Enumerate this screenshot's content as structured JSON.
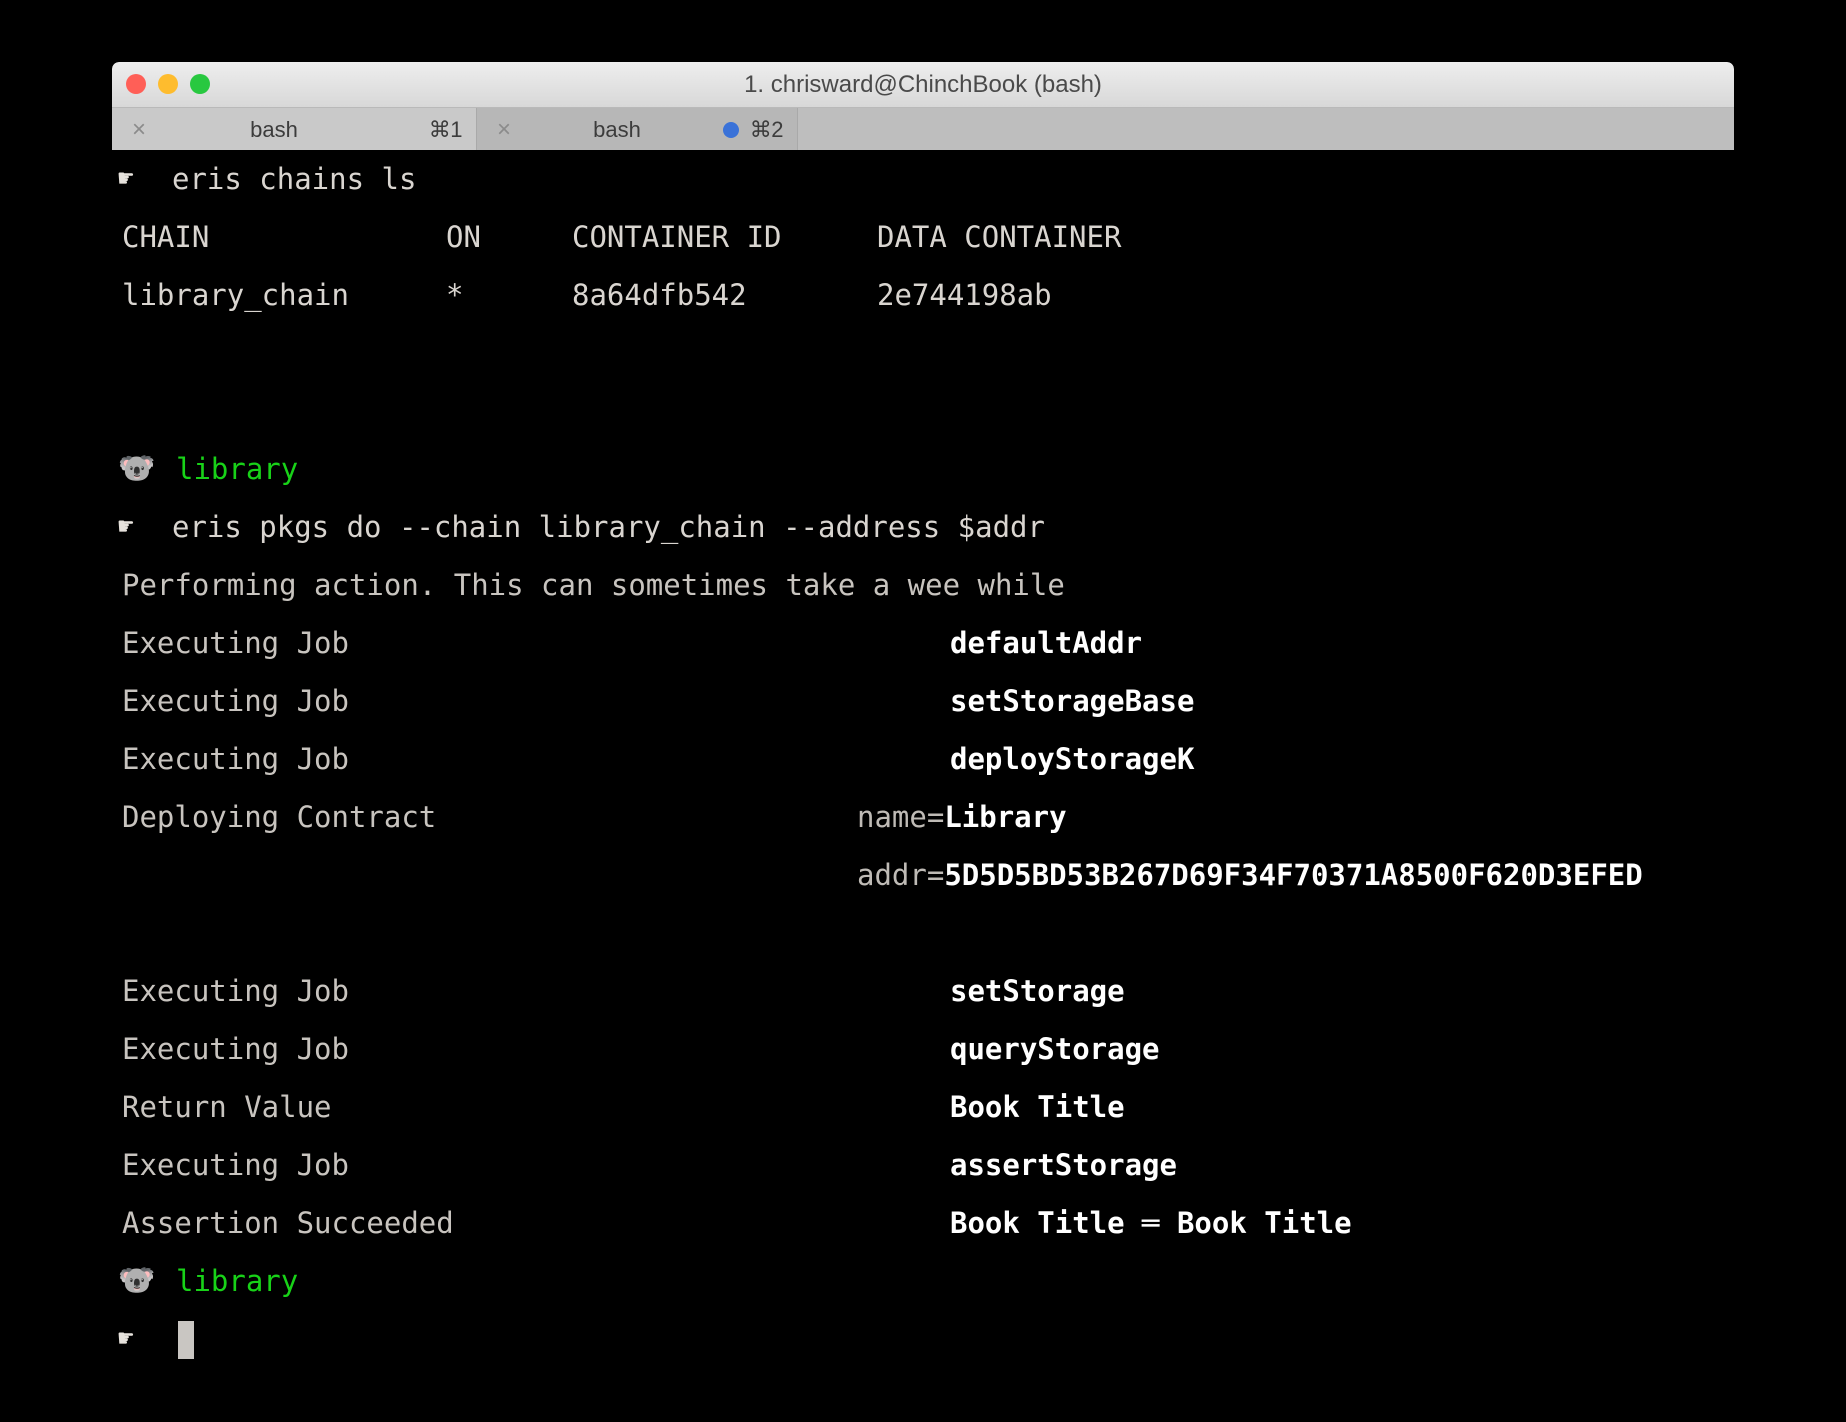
{
  "window": {
    "title": "1. chrisward@ChinchBook (bash)",
    "traffic_lights": [
      {
        "name": "close",
        "color": "#ff5f57"
      },
      {
        "name": "minimize",
        "color": "#febc2e"
      },
      {
        "name": "zoom",
        "color": "#28c840"
      }
    ]
  },
  "tabs": [
    {
      "label": "bash",
      "shortcut": "⌘1",
      "close": "×",
      "active": false,
      "has_activity_dot": false
    },
    {
      "label": "bash",
      "shortcut": "⌘2",
      "close": "×",
      "active": true,
      "has_activity_dot": true
    }
  ],
  "terminal": {
    "prompt_glyph": "☛",
    "koala_glyph": "🐨",
    "prompt_label": "library",
    "colors": {
      "background": "#000000",
      "foreground": "#d9d5d0",
      "prompt_green": "#18d218",
      "value_white": "#ffffff"
    },
    "command_1": "eris chains ls",
    "chains_table": {
      "headers": [
        "CHAIN",
        "ON",
        "CONTAINER ID",
        "DATA CONTAINER"
      ],
      "rows": [
        [
          "library_chain",
          "*",
          "8a64dfb542",
          "2e744198ab"
        ]
      ]
    },
    "command_2": "eris pkgs do --chain library_chain --address $addr",
    "status_message": "Performing action. This can sometimes take a wee while",
    "job_rows": [
      {
        "label": "Executing Job",
        "value": "defaultAddr"
      },
      {
        "label": "Executing Job",
        "value": "setStorageBase"
      },
      {
        "label": "Executing Job",
        "value": "deployStorageK"
      },
      {
        "label": "Deploying Contract",
        "key": "name=",
        "value": "Library"
      },
      {
        "label": "",
        "key": "addr=",
        "value": "5D5D5BD53B267D69F34F70371A8500F620D3EFED"
      },
      {
        "label": "Executing Job",
        "value": "setStorage"
      },
      {
        "label": "Executing Job",
        "value": "queryStorage"
      },
      {
        "label": "Return Value",
        "value": "Book Title"
      },
      {
        "label": "Executing Job",
        "value": "assertStorage"
      },
      {
        "label": "Assertion Succeeded",
        "value": "Book Title ═ Book Title"
      }
    ]
  }
}
